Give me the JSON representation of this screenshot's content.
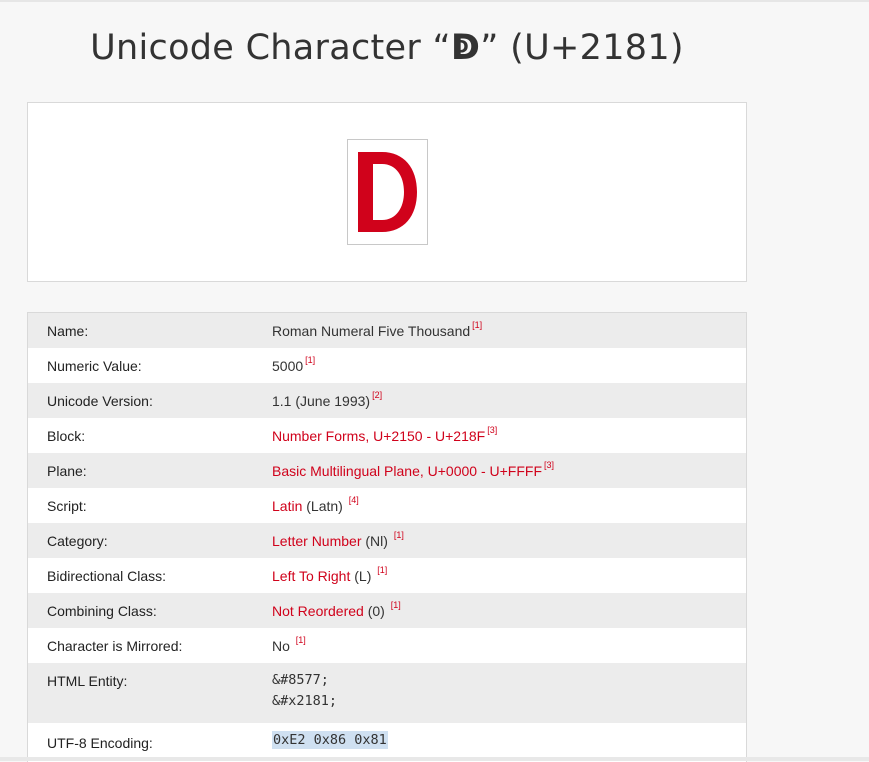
{
  "page": {
    "title_prefix": "Unicode Character “",
    "title_glyph": "ↁ",
    "title_suffix": "” (U+2181)"
  },
  "preview": {
    "glyph_icon": "roman-numeral-five-thousand-glyph",
    "accent": "#d0021b"
  },
  "rows": [
    {
      "key": "Name:",
      "value": "Roman Numeral Five Thousand",
      "ref": "[1]"
    },
    {
      "key": "Numeric Value:",
      "value": "5000",
      "ref": "[1]"
    },
    {
      "key": "Unicode Version:",
      "value": "1.1 (June 1993)",
      "ref": "[2]"
    },
    {
      "key": "Block:",
      "link": "Number Forms, U+2150 - U+218F",
      "ref": "[3]"
    },
    {
      "key": "Plane:",
      "link": "Basic Multilingual Plane, U+0000 - U+FFFF",
      "ref": "[3]"
    },
    {
      "key": "Script:",
      "link": "Latin",
      "extra": " (Latn) ",
      "ref": "[4]"
    },
    {
      "key": "Category:",
      "link": "Letter Number",
      "extra": " (Nl) ",
      "ref": "[1]"
    },
    {
      "key": "Bidirectional Class:",
      "link": "Left To Right",
      "extra": " (L) ",
      "ref": "[1]"
    },
    {
      "key": "Combining Class:",
      "link": "Not Reordered",
      "extra": " (0) ",
      "ref": "[1]"
    },
    {
      "key": "Character is Mirrored:",
      "value": "No ",
      "ref": "[1]"
    },
    {
      "key": "HTML Entity:",
      "code1": "&#8577;",
      "code2": "&#x2181;"
    },
    {
      "key": "UTF-8 Encoding:",
      "code1": "0xE2 0x86 0x81"
    }
  ]
}
